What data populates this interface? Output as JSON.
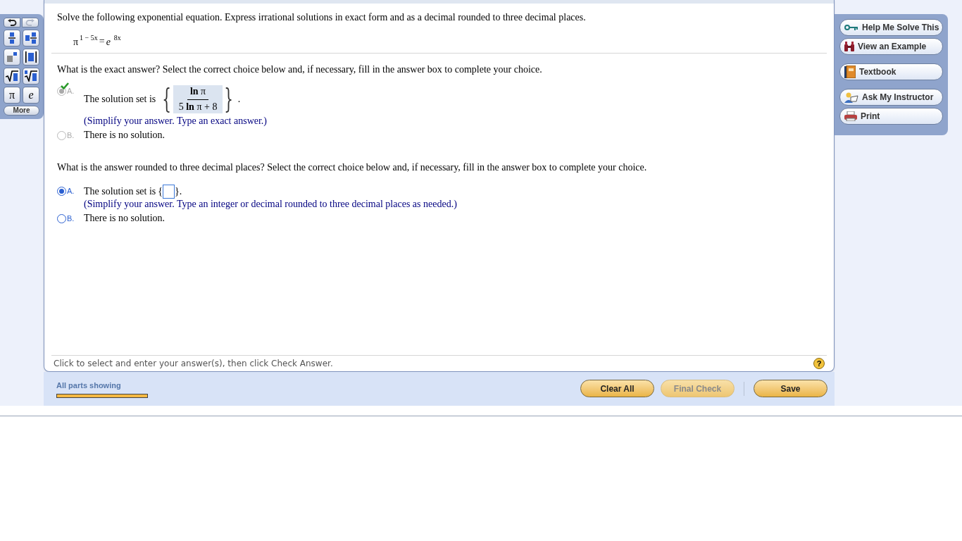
{
  "palette": {
    "history": [
      {
        "kind": "undo",
        "disabled": false
      },
      {
        "kind": "redo",
        "disabled": true
      }
    ],
    "buttons": [
      {
        "kind": "fraction"
      },
      {
        "kind": "mixed"
      },
      {
        "kind": "exponent"
      },
      {
        "kind": "abs"
      },
      {
        "kind": "sqrt"
      },
      {
        "kind": "nthroot"
      },
      {
        "kind": "symbol",
        "label": "π"
      },
      {
        "kind": "symbol",
        "label": "e",
        "italic": true
      }
    ],
    "more": "More"
  },
  "question": {
    "instruction": "Solve the following exponential equation. Express irrational solutions in exact form and as a decimal rounded to three decimal places.",
    "equation": {
      "left_base": "π",
      "left_exponent": "1 − 5x",
      "equals": "=",
      "right_base": "e",
      "right_exponent": "8x"
    }
  },
  "parts": [
    {
      "prompt": "What is the exact answer? Select the correct choice below and, if necessary, fill in the answer box to complete your choice.",
      "locked": true,
      "choices": [
        {
          "letter": "A.",
          "selected": true,
          "correct": true,
          "kind": "fraction",
          "text": "The solution set is",
          "open": "{",
          "numerator": "**ln** π",
          "denominator": "5 **ln** π + 8",
          "close": "}",
          "after": ".",
          "hint": "(Simplify your answer. Type an exact answer.)"
        },
        {
          "letter": "B.",
          "selected": false,
          "kind": "plain",
          "text": "There is no solution."
        }
      ]
    },
    {
      "prompt": "What is the answer rounded to three decimal places? Select the correct choice below and, if necessary, fill in the answer box to complete your choice.",
      "locked": false,
      "choices": [
        {
          "letter": "A.",
          "selected": true,
          "correct": false,
          "kind": "blank",
          "text": "The solution set is",
          "open": "{",
          "close": "}",
          "after": ".",
          "hint": "(Simplify your answer. Type an integer or decimal rounded to three decimal places as needed.)"
        },
        {
          "letter": "B.",
          "selected": false,
          "kind": "plain",
          "text": "There is no solution."
        }
      ]
    }
  ],
  "status": {
    "text": "Click to select and enter your answer(s), then click Check Answer.",
    "help": "?"
  },
  "progress": {
    "label": "All parts showing",
    "level": 1
  },
  "actions": [
    {
      "label": "Clear All",
      "disabled": false
    },
    {
      "label": "Final Check",
      "disabled": true
    },
    {
      "label": "Save",
      "disabled": false,
      "separated": true
    }
  ],
  "tools": [
    {
      "label": "Help Me Solve This",
      "kind": "key"
    },
    {
      "label": "View an Example",
      "kind": "binoculars"
    },
    {
      "label": "Textbook",
      "kind": "book",
      "gap": true
    },
    {
      "label": "Ask My Instructor",
      "kind": "instructor",
      "gap": true
    },
    {
      "label": "Print",
      "kind": "printer"
    }
  ]
}
